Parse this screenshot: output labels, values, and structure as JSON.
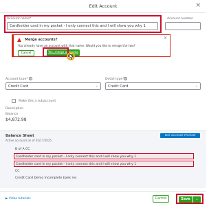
{
  "dialog": {
    "title": "Edit Account",
    "close_glyph": "×"
  },
  "account_name": {
    "label": "Account name*",
    "value": "Cardholder card in my pocket - I only connect this and I will show you why 1"
  },
  "account_number": {
    "label": "Account number",
    "value": ""
  },
  "merge_banner": {
    "title": "Merge accounts?",
    "message": "You already have an account with that name. Would you like to merge the two?",
    "cancel_label": "Cancel",
    "merge_label": "Yes, merge accounts",
    "close_glyph": "×"
  },
  "account_type": {
    "label": "Account type*",
    "value": "Credit Card"
  },
  "detail_type": {
    "label": "Detail type*",
    "value": "Credit Card"
  },
  "subaccount": {
    "label": "Make this a subaccount",
    "checked": false
  },
  "description": {
    "label": "Description",
    "value": ""
  },
  "balance": {
    "label": "Balance",
    "value": "$4,872.98"
  },
  "balance_sheet": {
    "title": "Balance Sheet",
    "subtitle": "Active accounts as of 02/17/2025",
    "edit_button": "EDIT ACCOUNT PREVIEW",
    "items": [
      "B of A CC",
      "Cardholder card in my pocket - I only connect this and I will show you why 1",
      "Cardholder card in my pocket - I only connect this and I will show you why 1",
      "CC",
      "Credit Card Demo Incomplete bank rec"
    ]
  },
  "footer": {
    "link_label": "Video tutorials",
    "cancel_label": "Cancel",
    "save_label": "Save",
    "save_dropdown_glyph": "⌄"
  },
  "colors": {
    "accent_green": "#2ca01c",
    "highlight_red": "#c8102e",
    "link_blue": "#0077c5"
  },
  "icons": [
    "close-icon",
    "warning-icon",
    "info-icon",
    "chevron-down-icon",
    "cursor-icon",
    "video-icon"
  ]
}
